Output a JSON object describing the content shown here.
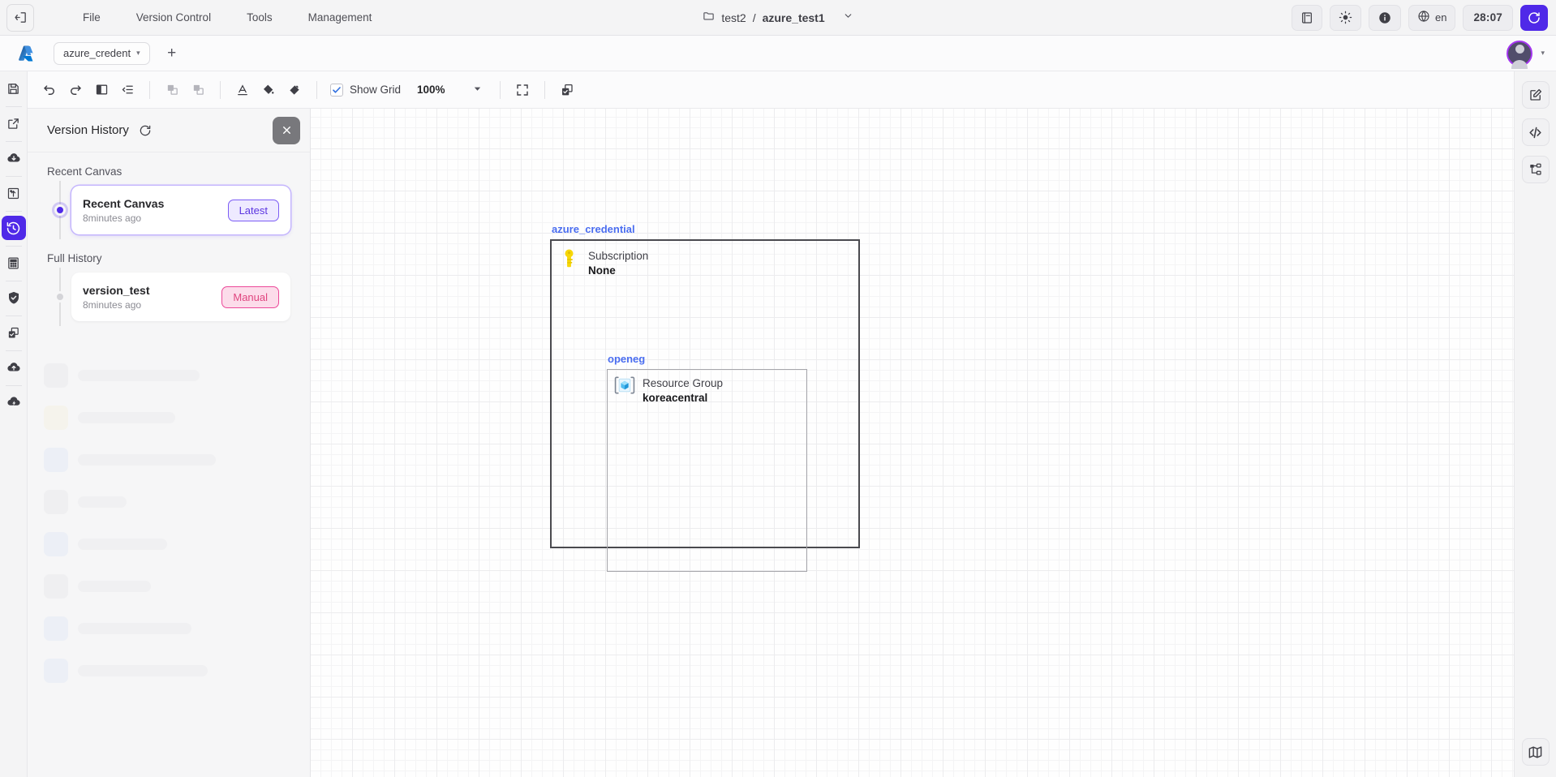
{
  "topbar": {
    "collapse_icon": "panel-collapse-icon",
    "menu": [
      {
        "label": "File"
      },
      {
        "label": "Version Control"
      },
      {
        "label": "Tools"
      },
      {
        "label": "Management"
      }
    ],
    "breadcrumb": {
      "folder_icon": "folder-icon",
      "project": "test2",
      "separator": " / ",
      "file": "azure_test1",
      "caret": "⌄"
    },
    "actions": {
      "book_icon": "book-icon",
      "theme_icon": "sun-icon",
      "info_icon": "info-icon",
      "globe_icon": "globe-icon",
      "language": "en",
      "timer": "28:07",
      "sync_icon": "sync-icon"
    }
  },
  "tabbar": {
    "logo": "azure-logo-icon",
    "tabs": [
      {
        "label": "azure_credent",
        "caret": "▾"
      }
    ],
    "add_label": "+",
    "avatar": "user-avatar",
    "avatar_caret": "▾"
  },
  "left_rail": [
    {
      "name": "save-icon"
    },
    {
      "name": "export-icon"
    },
    {
      "name": "download-cloud-icon"
    },
    {
      "name": "import-arrow-icon"
    },
    {
      "name": "history-clock-icon",
      "active": true
    },
    {
      "name": "calculator-icon"
    },
    {
      "name": "shield-check-icon"
    },
    {
      "name": "duplicate-check-icon"
    },
    {
      "name": "upload-cloud-icon"
    },
    {
      "name": "deploy-cloud-icon"
    }
  ],
  "toolbar": {
    "undo_icon": "undo-icon",
    "redo_icon": "redo-icon",
    "panel_icon": "split-panel-icon",
    "indent_icon": "indent-icon",
    "group_icon": "group-icon",
    "ungroup_icon": "ungroup-icon",
    "text_color_icon": "text-color-icon",
    "fill_color_icon": "fill-color-icon",
    "paint_icon": "paint-bucket-icon",
    "show_grid_label": "Show Grid",
    "show_grid_checked": true,
    "zoom_level": "100%",
    "zoom_caret": "▾",
    "fullscreen_icon": "fullscreen-icon",
    "select_all_icon": "select-all-icon"
  },
  "panel": {
    "title": "Version History",
    "refresh_icon": "refresh-icon",
    "close_icon": "close-icon",
    "sections": [
      {
        "label": "Recent Canvas",
        "items": [
          {
            "name": "Recent Canvas",
            "time": "8minutes ago",
            "badge": "Latest",
            "badge_type": "latest",
            "selected": true
          }
        ]
      },
      {
        "label": "Full History",
        "items": [
          {
            "name": "version_test",
            "time": "8minutes ago",
            "badge": "Manual",
            "badge_type": "manual",
            "selected": false
          }
        ]
      }
    ]
  },
  "canvas": {
    "outer_node": {
      "label": "azure_credential",
      "icon": "key-icon",
      "type": "Subscription",
      "value": "None"
    },
    "inner_node": {
      "label": "openeg",
      "icon": "resource-group-cube-icon",
      "type": "Resource Group",
      "value": "koreacentral"
    }
  },
  "right_rail": {
    "top": [
      {
        "name": "edit-note-icon"
      },
      {
        "name": "code-icon"
      },
      {
        "name": "hierarchy-icon"
      }
    ],
    "bottom": {
      "name": "map-icon"
    }
  },
  "colors": {
    "accent": "#4f29e8",
    "latest_badge_border": "#7c5cf5",
    "manual_badge_border": "#ec4899",
    "node_label_blue": "#4a6df0",
    "key_yellow": "#f5d020",
    "panel_bg": "#f6f6f7"
  }
}
